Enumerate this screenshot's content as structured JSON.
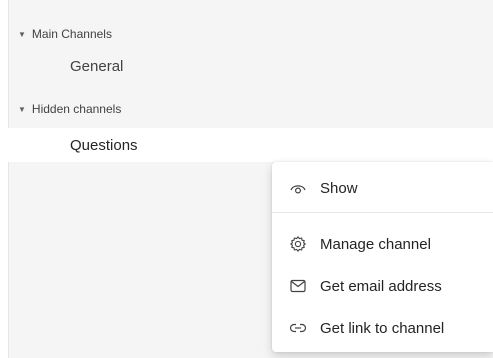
{
  "sidebar": {
    "sections": [
      {
        "title": "Main Channels",
        "channels": [
          "General"
        ]
      },
      {
        "title": "Hidden channels",
        "channels": [
          "Questions"
        ]
      }
    ]
  },
  "context_menu": {
    "items": [
      {
        "label": "Show",
        "icon": "eye-icon"
      },
      {
        "label": "Manage channel",
        "icon": "gear-icon"
      },
      {
        "label": "Get email address",
        "icon": "mail-icon"
      },
      {
        "label": "Get link to channel",
        "icon": "link-icon"
      }
    ]
  }
}
